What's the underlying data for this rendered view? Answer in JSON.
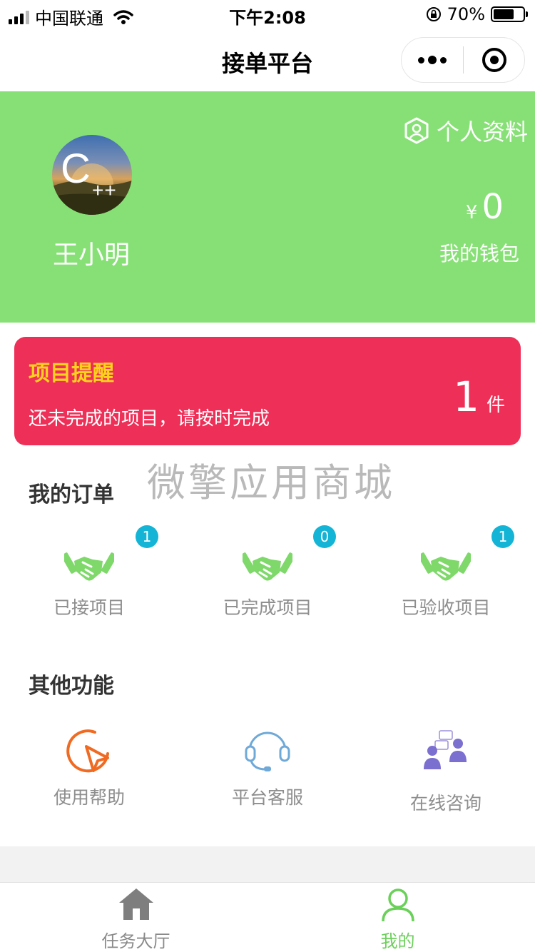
{
  "status_bar": {
    "carrier": "中国联通",
    "time": "下午2:08",
    "battery": "70%",
    "battery_level": 0.7
  },
  "nav": {
    "title": "接单平台"
  },
  "header": {
    "profile_link": "个人资料",
    "avatar_text": "C",
    "avatar_suffix": "++",
    "username": "王小明",
    "currency": "¥",
    "wallet_amount": "0",
    "wallet_label": "我的钱包"
  },
  "reminder": {
    "title": "项目提醒",
    "text": "还未完成的项目，请按时完成",
    "count": "1",
    "unit": "件"
  },
  "watermark": "微擎应用商城",
  "orders": {
    "title": "我的订单",
    "items": [
      {
        "label": "已接项目",
        "badge": "1",
        "icon": "handshake-icon"
      },
      {
        "label": "已完成项目",
        "badge": "0",
        "icon": "handshake-icon"
      },
      {
        "label": "已验收项目",
        "badge": "1",
        "icon": "handshake-icon"
      }
    ]
  },
  "functions": {
    "title": "其他功能",
    "items": [
      {
        "label": "使用帮助",
        "icon": "cursor-help-icon"
      },
      {
        "label": "平台客服",
        "icon": "headset-icon"
      },
      {
        "label": "在线咨询",
        "icon": "consult-icon"
      }
    ]
  },
  "tabbar": {
    "items": [
      {
        "label": "任务大厅",
        "icon": "home-icon",
        "active": false
      },
      {
        "label": "我的",
        "icon": "user-icon",
        "active": true
      }
    ]
  },
  "colors": {
    "header_bg": "#87e076",
    "reminder_bg": "#ee2f57",
    "reminder_title": "#ffd21e",
    "badge": "#13b4d6",
    "tab_active": "#6bd05a",
    "tab_inactive": "#8a8a8a"
  }
}
